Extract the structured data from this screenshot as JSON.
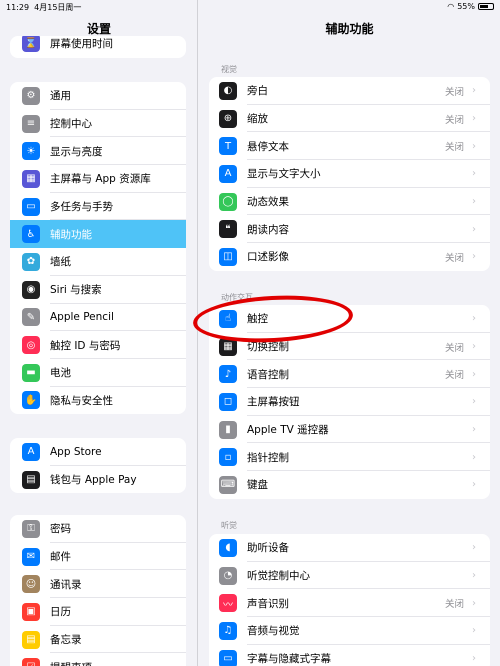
{
  "status": {
    "time": "11:29",
    "date": "4月15日周一",
    "battery": "55%",
    "battery_level": 0.55
  },
  "sidebar": {
    "title": "设置",
    "top_partial": "屏幕使用时间",
    "group1": [
      {
        "label": "通用",
        "icon": "gear-icon",
        "color": "#8e8e93"
      },
      {
        "label": "控制中心",
        "icon": "toggles-icon",
        "color": "#8e8e93"
      },
      {
        "label": "显示与亮度",
        "icon": "sun-icon",
        "color": "#007aff"
      },
      {
        "label": "主屏幕与 App 资源库",
        "icon": "grid-icon",
        "color": "#5856d6"
      },
      {
        "label": "多任务与手势",
        "icon": "multitask-icon",
        "color": "#007aff"
      },
      {
        "label": "辅助功能",
        "icon": "accessibility-icon",
        "color": "#007aff",
        "selected": true
      },
      {
        "label": "墙纸",
        "icon": "flower-icon",
        "color": "#34aadc"
      },
      {
        "label": "Siri 与搜索",
        "icon": "siri-icon",
        "color": "#222222"
      },
      {
        "label": "Apple Pencil",
        "icon": "pencil-icon",
        "color": "#8e8e93"
      },
      {
        "label": "触控 ID 与密码",
        "icon": "fingerprint-icon",
        "color": "#ff2d55"
      },
      {
        "label": "电池",
        "icon": "battery-icon",
        "color": "#34c759"
      },
      {
        "label": "隐私与安全性",
        "icon": "hand-icon",
        "color": "#007aff"
      }
    ],
    "group2": [
      {
        "label": "App Store",
        "icon": "appstore-icon",
        "color": "#007aff"
      },
      {
        "label": "钱包与 Apple Pay",
        "icon": "wallet-icon",
        "color": "#1c1c1e"
      }
    ],
    "group3": [
      {
        "label": "密码",
        "icon": "key-icon",
        "color": "#8e8e93"
      },
      {
        "label": "邮件",
        "icon": "mail-icon",
        "color": "#007aff"
      },
      {
        "label": "通讯录",
        "icon": "contacts-icon",
        "color": "#a2845e"
      },
      {
        "label": "日历",
        "icon": "calendar-icon",
        "color": "#ff3b30"
      },
      {
        "label": "备忘录",
        "icon": "notes-icon",
        "color": "#ffcc00"
      },
      {
        "label": "提醒事项",
        "icon": "reminders-icon",
        "color": "#ff3b30"
      }
    ]
  },
  "main": {
    "title": "辅助功能",
    "vision_header": "视觉",
    "vision": [
      {
        "label": "旁白",
        "value": "关闭",
        "icon": "voiceover-icon",
        "color": "#1c1c1e"
      },
      {
        "label": "缩放",
        "value": "关闭",
        "icon": "zoom-icon",
        "color": "#1c1c1e"
      },
      {
        "label": "悬停文本",
        "value": "关闭",
        "icon": "hover-text-icon",
        "color": "#007aff"
      },
      {
        "label": "显示与文字大小",
        "value": "",
        "icon": "text-size-icon",
        "color": "#007aff"
      },
      {
        "label": "动态效果",
        "value": "",
        "icon": "motion-icon",
        "color": "#34c759"
      },
      {
        "label": "朗读内容",
        "value": "",
        "icon": "speech-icon",
        "color": "#1c1c1e"
      },
      {
        "label": "口述影像",
        "value": "关闭",
        "icon": "audio-description-icon",
        "color": "#007aff"
      }
    ],
    "physical_header": "动作交互",
    "physical": [
      {
        "label": "触控",
        "value": "",
        "icon": "touch-icon",
        "color": "#007aff"
      },
      {
        "label": "切换控制",
        "value": "关闭",
        "icon": "switch-control-icon",
        "color": "#1c1c1e"
      },
      {
        "label": "语音控制",
        "value": "关闭",
        "icon": "voice-control-icon",
        "color": "#007aff"
      },
      {
        "label": "主屏幕按钮",
        "value": "",
        "icon": "home-button-icon",
        "color": "#007aff"
      },
      {
        "label": "Apple TV 遥控器",
        "value": "",
        "icon": "remote-icon",
        "color": "#8e8e93"
      },
      {
        "label": "指针控制",
        "value": "",
        "icon": "pointer-icon",
        "color": "#007aff"
      },
      {
        "label": "键盘",
        "value": "",
        "icon": "keyboard-icon",
        "color": "#8e8e93"
      }
    ],
    "hearing_header": "听觉",
    "hearing": [
      {
        "label": "助听设备",
        "value": "",
        "icon": "ear-icon",
        "color": "#007aff"
      },
      {
        "label": "听觉控制中心",
        "value": "",
        "icon": "hearing-control-icon",
        "color": "#8e8e93"
      },
      {
        "label": "声音识别",
        "value": "关闭",
        "icon": "sound-recognition-icon",
        "color": "#ff2d55"
      },
      {
        "label": "音频与视觉",
        "value": "",
        "icon": "audio-visual-icon",
        "color": "#007aff"
      },
      {
        "label": "字幕与隐藏式字幕",
        "value": "",
        "icon": "subtitles-icon",
        "color": "#007aff"
      }
    ]
  },
  "annotation": {
    "color": "#e00000"
  }
}
